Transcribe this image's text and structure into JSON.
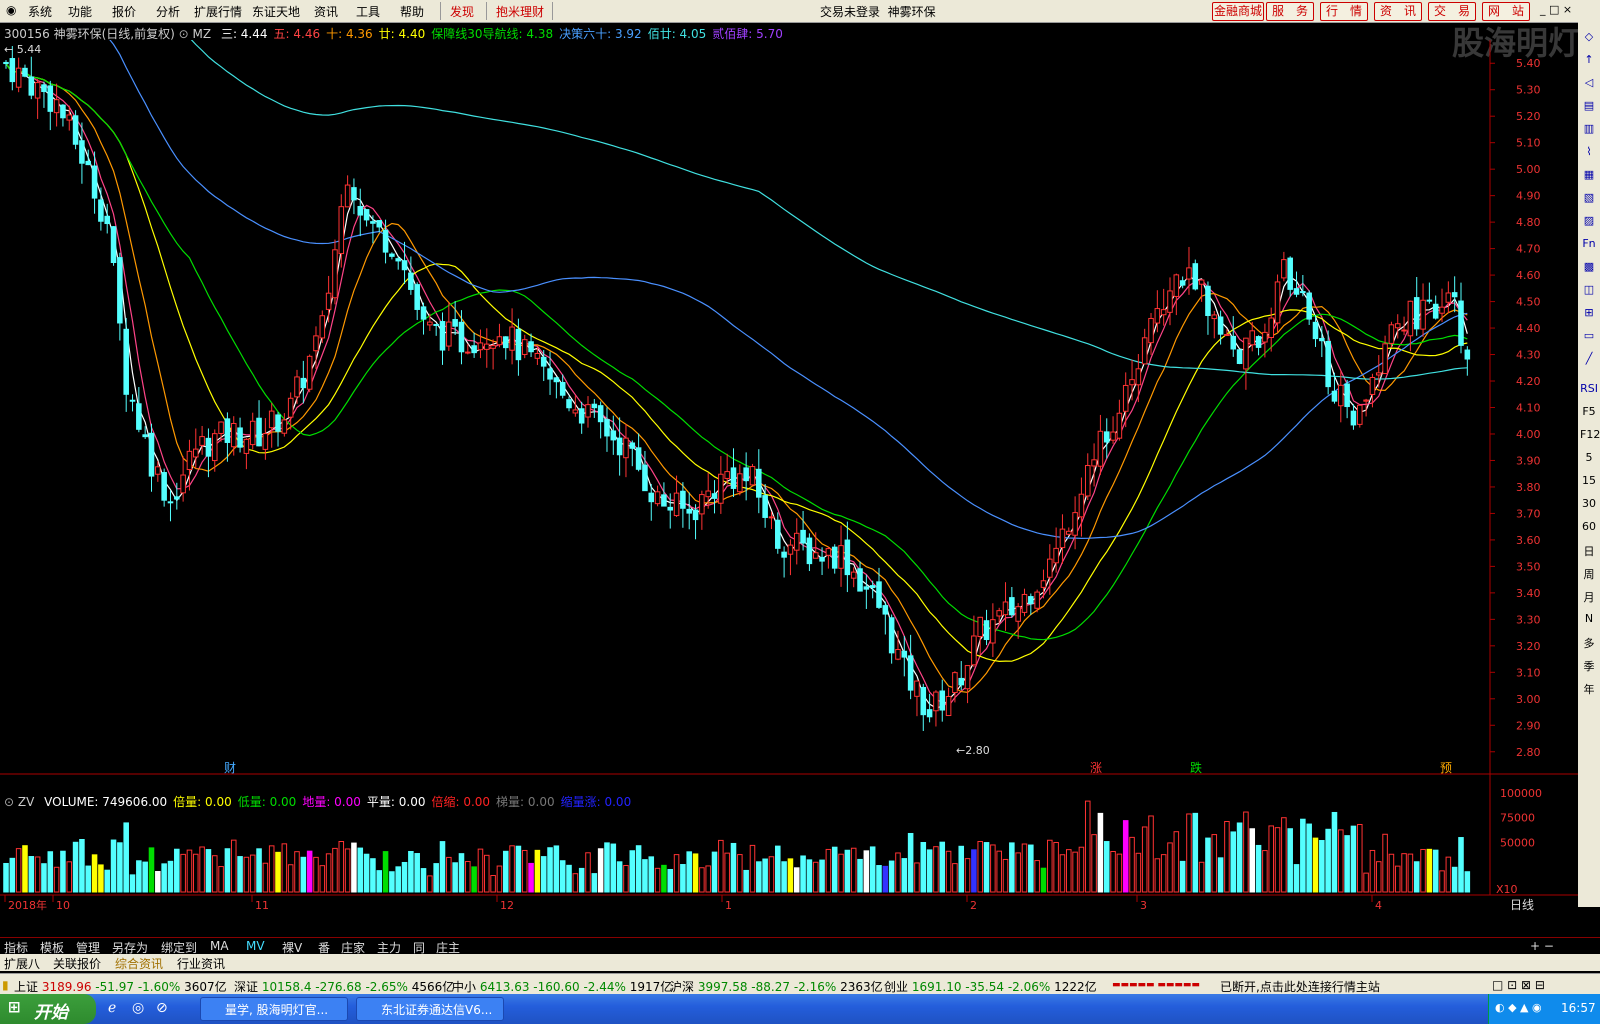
{
  "menu": {
    "items": [
      "系统",
      "功能",
      "报价",
      "分析",
      "扩展行情",
      "东证天地",
      "资讯",
      "工具",
      "帮助"
    ],
    "special": [
      "发现",
      "抱米理财"
    ],
    "login_status": "交易未登录",
    "stock_name": "神雾环保",
    "right_buttons": [
      "金融商城",
      "服　务",
      "行　情",
      "资　讯",
      "交　易",
      "网　站"
    ]
  },
  "watermark": "股海明灯",
  "price_header": {
    "code_name": "300156 神雾环保(日线,前复权)",
    "indicator": "MZ",
    "items": [
      {
        "label": "三:",
        "value": "4.44",
        "color": "#ffffff"
      },
      {
        "label": "五:",
        "value": "4.46",
        "color": "#ff4444"
      },
      {
        "label": "十:",
        "value": "4.36",
        "color": "#ff9900"
      },
      {
        "label": "廿:",
        "value": "4.40",
        "color": "#ffff00"
      },
      {
        "label": "保障线30导航线:",
        "value": "4.38",
        "color": "#00dd00"
      },
      {
        "label": "决策六十:",
        "value": "3.92",
        "color": "#4aa0ff"
      },
      {
        "label": "佰廿:",
        "value": "4.05",
        "color": "#40e0e0"
      },
      {
        "label": "贰佰肆:",
        "value": "5.70",
        "color": "#a040ff"
      }
    ]
  },
  "volume_header": {
    "indicator": "ZV",
    "items": [
      {
        "label": "VOLUME:",
        "value": "749606.00",
        "color": "#ffffff"
      },
      {
        "label": "倍量:",
        "value": "0.00",
        "color": "#ffff00"
      },
      {
        "label": "低量:",
        "value": "0.00",
        "color": "#00dd00"
      },
      {
        "label": "地量:",
        "value": "0.00",
        "color": "#ff00ff"
      },
      {
        "label": "平量:",
        "value": "0.00",
        "color": "#ffffff"
      },
      {
        "label": "倍缩:",
        "value": "0.00",
        "color": "#ff2222"
      },
      {
        "label": "梯量:",
        "value": "0.00",
        "color": "#777777"
      },
      {
        "label": "缩量涨:",
        "value": "0.00",
        "color": "#2222ff"
      }
    ]
  },
  "chart_data": {
    "type": "candlestick",
    "price_axis": {
      "min": 2.8,
      "max": 5.4,
      "ticks": [
        "5.40",
        "5.30",
        "5.20",
        "5.10",
        "5.00",
        "4.90",
        "4.80",
        "4.70",
        "4.60",
        "4.50",
        "4.40",
        "4.30",
        "4.20",
        "4.10",
        "4.00",
        "3.90",
        "3.80",
        "3.70",
        "3.60",
        "3.50",
        "3.40",
        "3.30",
        "3.20",
        "3.10",
        "3.00",
        "2.90",
        "2.80"
      ]
    },
    "high_label": "5.44",
    "low_label": "2.80",
    "volume_axis": {
      "ticks": [
        "100000",
        "75000",
        "50000"
      ],
      "unit": "X10",
      "max": 105000
    },
    "x_labels": [
      "2018年",
      "10",
      "11",
      "12",
      "1",
      "2",
      "3",
      "4"
    ],
    "period_label": "日线",
    "markers": [
      "财",
      "涨",
      "跌",
      "预"
    ],
    "ma_colors": [
      "#ffffff",
      "#ff4488",
      "#ff9900",
      "#ffff00",
      "#00dd00",
      "#4a90ff",
      "#40e0e0"
    ]
  },
  "tabs1": [
    "指标",
    "模板",
    "管理",
    "另存为",
    "绑定到",
    "MA",
    "MV",
    "裸V",
    "番",
    "庄家",
    "主力",
    "同",
    "庄主"
  ],
  "tabs2": [
    "扩展八",
    "关联报价",
    "综合资讯",
    "行业资讯"
  ],
  "status": {
    "sh": {
      "name": "上证",
      "value": "3189.96",
      "chg": "-51.97",
      "pct": "-1.60%",
      "amt": "3607亿"
    },
    "sz": {
      "name": "深证",
      "value": "10158.4",
      "chg": "-276.68",
      "pct": "-2.65%",
      "amt": "4566亿"
    },
    "zx": {
      "name": "中小",
      "value": "6413.63",
      "chg": "-160.60",
      "pct": "-2.44%",
      "amt": "1917亿"
    },
    "hs": {
      "name": "沪深",
      "value": "3997.58",
      "chg": "-88.27",
      "pct": "-2.16%",
      "amt": "2363亿"
    },
    "cy": {
      "name": "创业",
      "value": "1691.10",
      "chg": "-35.54",
      "pct": "-2.06%",
      "amt": "1222亿"
    },
    "conn": "已断开,点击此处连接行情主站"
  },
  "taskbar": {
    "start": "开始",
    "tasks": [
      "量学, 股海明灯官...",
      "东北证券通达信V6..."
    ],
    "clock": "16:57"
  },
  "right_tools": [
    "RSI",
    "F5",
    "F12",
    "5",
    "15",
    "30",
    "60",
    "日",
    "周",
    "月",
    "N",
    "多",
    "季",
    "年"
  ]
}
